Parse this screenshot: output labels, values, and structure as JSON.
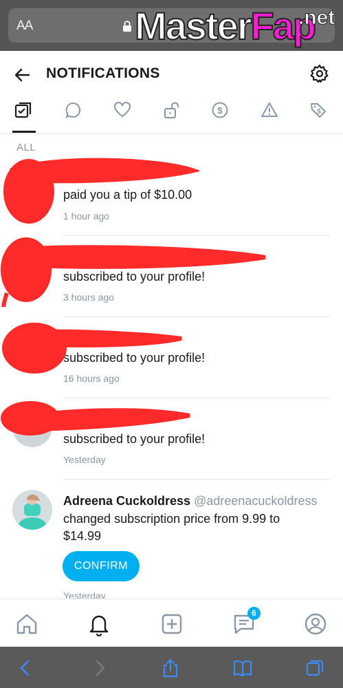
{
  "browser": {
    "text_size_label": "AA",
    "watermark": {
      "master": "Master",
      "fap": "Fap",
      "net": ".net"
    }
  },
  "header": {
    "title": "NOTIFICATIONS"
  },
  "tabs": [
    {
      "icon": "checklist-icon",
      "active": true
    },
    {
      "icon": "comment-icon"
    },
    {
      "icon": "heart-icon"
    },
    {
      "icon": "unlock-icon"
    },
    {
      "icon": "dollar-icon"
    },
    {
      "icon": "warning-icon"
    },
    {
      "icon": "price-tag-icon"
    }
  ],
  "section_label": "ALL",
  "notifications": [
    {
      "message": "paid you a tip of $10.00",
      "time": "1 hour ago",
      "redacted": true
    },
    {
      "message": "subscribed to your profile!",
      "time": "3 hours ago",
      "redacted": true
    },
    {
      "message": "subscribed to your profile!",
      "time": "16 hours ago",
      "redacted": true
    },
    {
      "message": "subscribed to your profile!",
      "time": "Yesterday",
      "redacted": true
    },
    {
      "name": "Adreena Cuckoldress",
      "handle": "@adreenacuckoldress",
      "message_line1": "changed subscription price from 9.99 to",
      "message_line2": "$14.99",
      "button": "CONFIRM",
      "time": "Yesterday"
    }
  ],
  "bottom_nav": {
    "items": [
      "home-icon",
      "bell-icon",
      "add-post-icon",
      "messages-icon",
      "profile-icon"
    ],
    "messages_badge": "6"
  },
  "colors": {
    "accent": "#00aff0",
    "scribble": "#ff2a2a",
    "muted": "#8a96a3"
  }
}
